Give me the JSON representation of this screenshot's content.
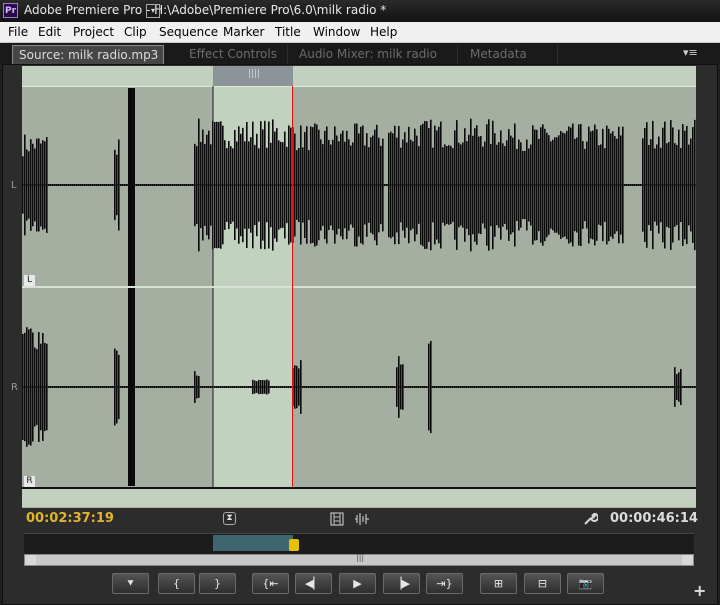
{
  "window": {
    "logo_text": "Pr",
    "title": "Adobe Premiere Pro - H:\\Adobe\\Premiere Pro\\6.0\\milk radio *"
  },
  "menu": [
    "File",
    "Edit",
    "Project",
    "Clip",
    "Sequence",
    "Marker",
    "Title",
    "Window",
    "Help"
  ],
  "tabs": {
    "source": "Source: milk radio.mp3",
    "effect_controls": "Effect Controls",
    "audio_mixer": "Audio Mixer: milk radio",
    "metadata": "Metadata"
  },
  "channels": {
    "left": "L",
    "right": "R"
  },
  "timecode": {
    "current": "00:02:37:19",
    "duration": "00:00:46:14"
  },
  "icons": {
    "dropdown": "▾",
    "panel_menu": "▾≡",
    "marker_status": "⧗",
    "filmstrip": "film-strip-icon",
    "audio": "audio-waveform-icon",
    "wrench": "wrench-icon"
  },
  "transport": [
    {
      "id": "add-marker",
      "glyph": "⯆"
    },
    {
      "id": "mark-in",
      "glyph": "{"
    },
    {
      "id": "mark-out",
      "glyph": "}"
    },
    {
      "id": "go-to-in",
      "glyph": "{⇤"
    },
    {
      "id": "step-back",
      "glyph": "◀▏"
    },
    {
      "id": "play",
      "glyph": "▶"
    },
    {
      "id": "step-forward",
      "glyph": "▕▶"
    },
    {
      "id": "go-to-out",
      "glyph": "⇥}"
    },
    {
      "id": "insert",
      "glyph": "⊞"
    },
    {
      "id": "overwrite",
      "glyph": "⊟"
    },
    {
      "id": "export-frame",
      "glyph": "📷"
    }
  ],
  "add_button": "+",
  "colors": {
    "timecode_current": "#e2b52c",
    "playhead": "#e01010",
    "waveform_bg": "#a4afa2",
    "selection": "#c1d3bf"
  }
}
